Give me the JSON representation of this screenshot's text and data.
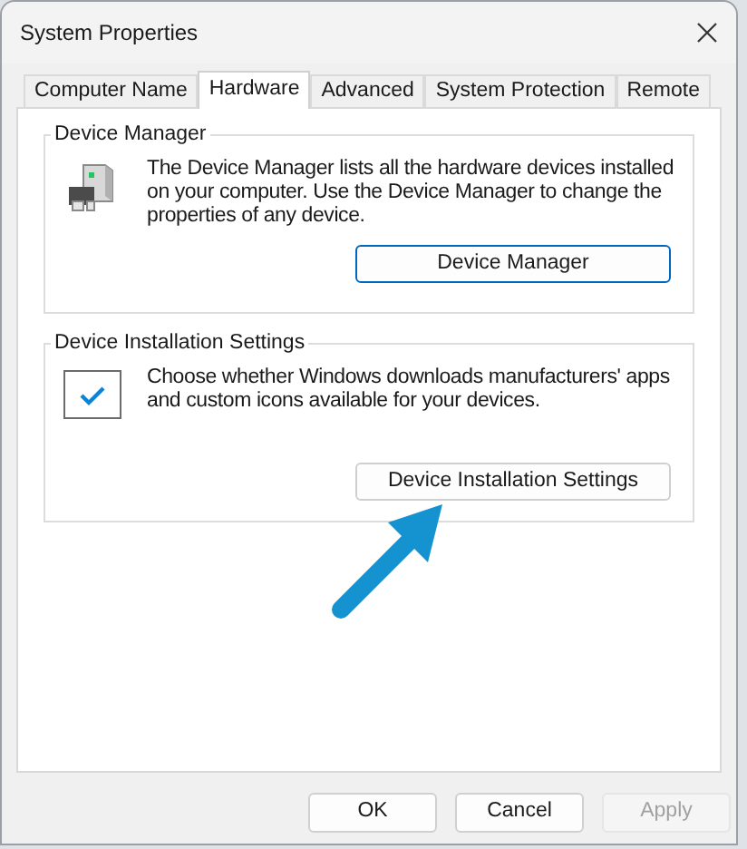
{
  "window": {
    "title": "System Properties"
  },
  "tabs": [
    {
      "label": "Computer Name",
      "selected": false
    },
    {
      "label": "Hardware",
      "selected": true
    },
    {
      "label": "Advanced",
      "selected": false
    },
    {
      "label": "System Protection",
      "selected": false
    },
    {
      "label": "Remote",
      "selected": false
    }
  ],
  "groups": [
    {
      "kind": "device-manager",
      "title": "Device Manager",
      "text": "The Device Manager lists all the hardware devices installed on your computer. Use the Device Manager to change the properties of any device.",
      "button": "Device Manager",
      "focused": true
    },
    {
      "kind": "installation",
      "title": "Device Installation Settings",
      "text": "Choose whether Windows downloads manufacturers' apps and custom icons available for your devices.",
      "button": "Device Installation Settings",
      "focused": false
    }
  ],
  "buttons": [
    {
      "label": "OK",
      "disabled": false
    },
    {
      "label": "Cancel",
      "disabled": false
    },
    {
      "label": "Apply",
      "disabled": true
    }
  ]
}
